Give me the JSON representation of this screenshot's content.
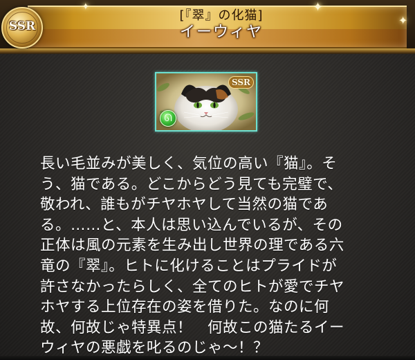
{
  "header": {
    "title": "[『翠』の化猫]",
    "name": "イーウィヤ",
    "rarity": "SSR"
  },
  "card": {
    "rarity": "SSR",
    "element_icon": "wind-element-icon",
    "element_color": "#3bbd37",
    "frame_color": "#6de0d0"
  },
  "description": "長い毛並みが美しく、気位の高い『猫』。そ\nう、猫である。どこからどう見ても完璧で、\n敬われ、誰もがチヤホヤして当然の猫であ\nる。……と、本人は思い込んでいるが、その\n正体は風の元素を生み出し世界の理である六\n竜の『翠』。ヒトに化けることはプライドが\n許さなかったらしく、全てのヒトが愛でチヤ\nホヤする上位存在の姿を借りた。なのに何\n故、何故じゃ特異点！　何故この猫たるイー\nウィヤの悪戯を叱るのじゃ～！？",
  "colors": {
    "banner_gold": "#e8c25f",
    "background": "#2a2826",
    "text": "#ffffff"
  }
}
